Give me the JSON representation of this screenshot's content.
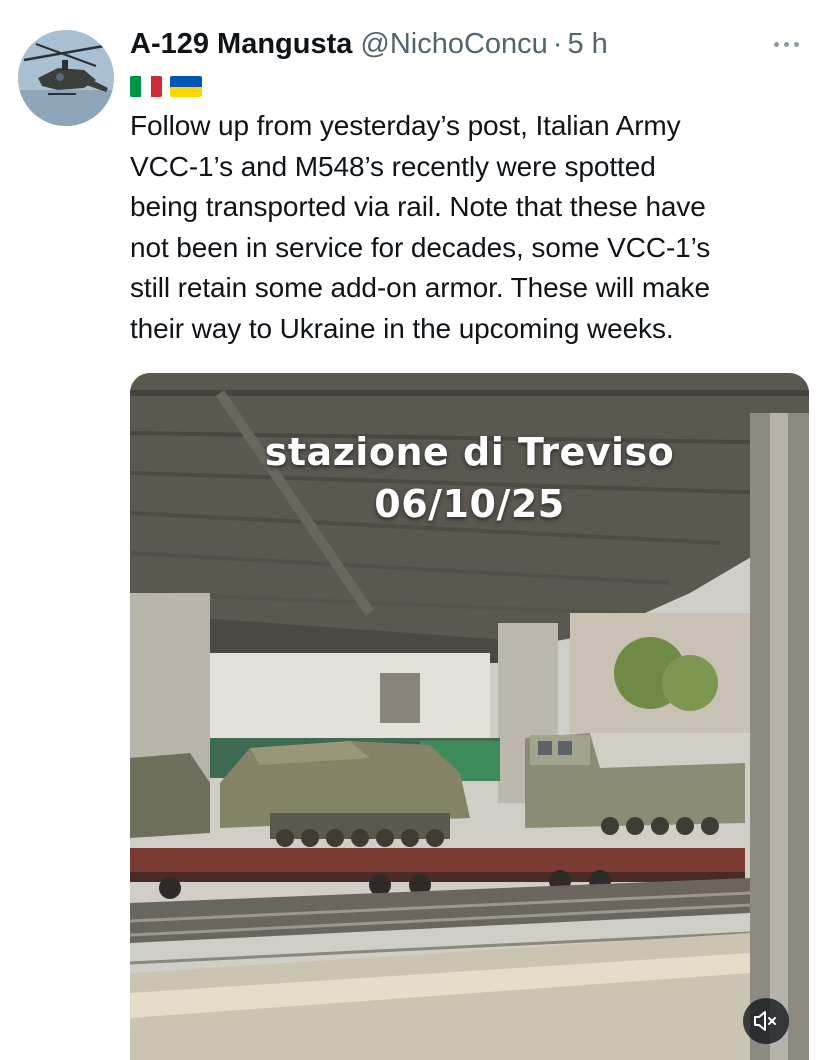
{
  "tweet": {
    "display_name": "A-129 Mangusta",
    "handle": "@NichoConcu",
    "separator": "·",
    "time": "5 h",
    "flags": [
      "italy-flag",
      "ukraine-flag"
    ],
    "text_lines": [
      "Follow up from yesterday’s post, Italian Army",
      "VCC-1’s and M548’s recently were spotted",
      "being transported via rail. Note that these have",
      "not been in service for decades, some VCC-1’s",
      "still retain some add-on armor. These will make",
      "their way to Ukraine in the upcoming weeks."
    ]
  },
  "media": {
    "overlay_line1": "stazione di Treviso",
    "overlay_line2": "06/10/25",
    "mute_icon": "volume-muted-icon"
  },
  "colors": {
    "text": "#0f1419",
    "secondary": "#536471"
  }
}
